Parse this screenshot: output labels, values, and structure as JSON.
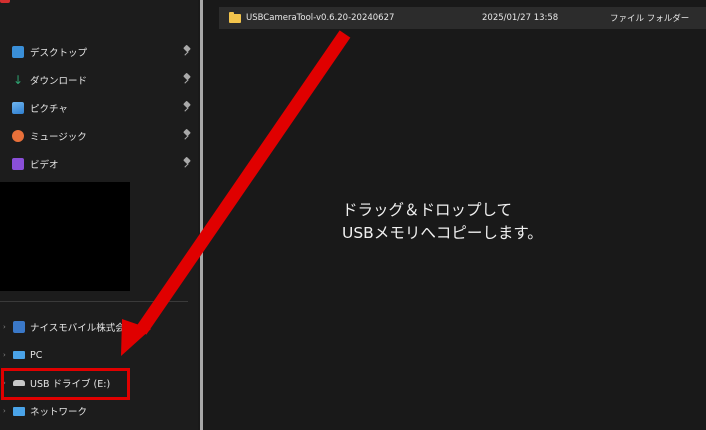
{
  "sidebar": {
    "partial_item": "",
    "quick_access": [
      {
        "label": "デスクトップ",
        "icon": "desktop-icon",
        "color": "#3a8fd8",
        "pinned": true
      },
      {
        "label": "ダウンロード",
        "icon": "download-icon",
        "color": "#2ea572",
        "pinned": true
      },
      {
        "label": "ピクチャ",
        "icon": "pictures-icon",
        "color": "#3f8fe0",
        "pinned": true
      },
      {
        "label": "ミュージック",
        "icon": "music-icon",
        "color": "#e8703a",
        "pinned": true
      },
      {
        "label": "ビデオ",
        "icon": "videos-icon",
        "color": "#8a4fd8",
        "pinned": true
      }
    ],
    "tree": [
      {
        "label": "ナイスモバイル株式会社",
        "icon": "company-icon",
        "color": "#3a78c8"
      },
      {
        "label": "PC",
        "icon": "pc-icon",
        "color": "#4aa3e8"
      },
      {
        "label": "USB ドライブ (E:)",
        "icon": "usb-drive-icon",
        "color": "#c8c8c8"
      },
      {
        "label": "ネットワーク",
        "icon": "network-icon",
        "color": "#4aa3e8"
      }
    ]
  },
  "main": {
    "file_row": {
      "name": "USBCameraTool-v0.6.20-20240627",
      "date": "2025/01/27 13:58",
      "type": "ファイル フォルダー",
      "icon": "folder-icon"
    },
    "instruction": "ドラッグ＆ドロップして\nUSBメモリへコピーします。"
  },
  "annotation": {
    "color": "#e00000"
  }
}
